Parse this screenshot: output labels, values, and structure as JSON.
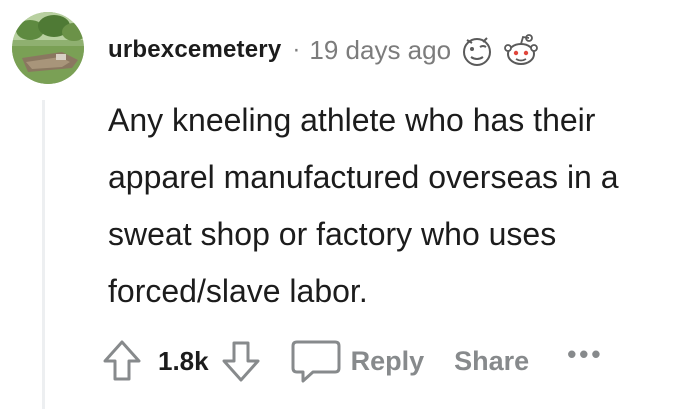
{
  "comment": {
    "username": "urbexcemetery",
    "separator": "·",
    "timestamp": "19 days ago",
    "body": "Any kneeling athlete who has their apparel manufactured overseas in a sweat shop or factory who uses forced/slave labor.",
    "awards": [
      "award-face-icon",
      "award-snoo-icon"
    ]
  },
  "actions": {
    "score": "1.8k",
    "reply_label": "Reply",
    "share_label": "Share",
    "more_label": "•••"
  },
  "colors": {
    "text": "#1c1c1c",
    "meta": "#7c7c7c",
    "action": "#878a8c",
    "thread_line": "#edeff1"
  }
}
